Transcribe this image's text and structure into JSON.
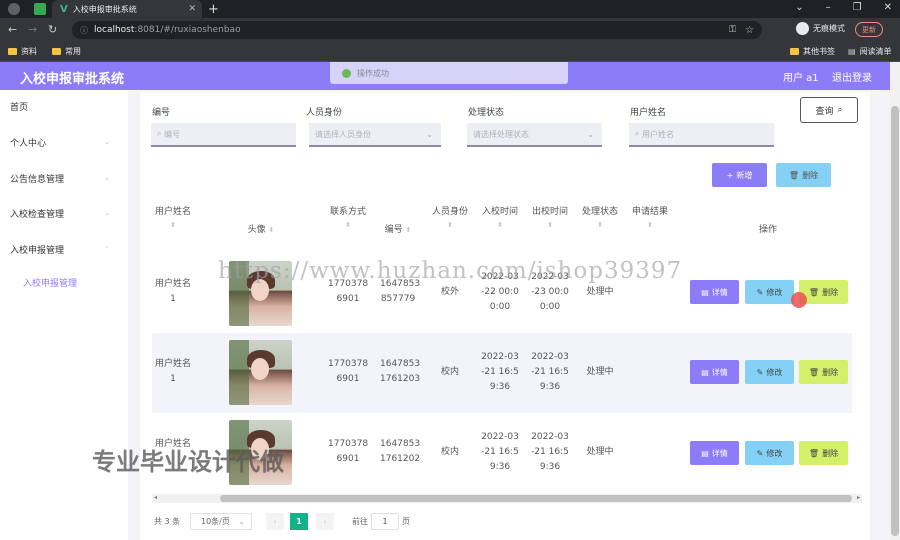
{
  "browser": {
    "tab_title": "入校申报审批系统",
    "new_tab": "+",
    "url_host": "localhost",
    "url_path": ":8081/#/ruxiaoshenbao",
    "incognito_label": "无痕模式",
    "update_label": "更新",
    "bookmarks": [
      "资料",
      "常用"
    ],
    "bookmarks_right": [
      "其他书签",
      "阅读清单"
    ]
  },
  "header": {
    "title": "入校申报审批系统",
    "toast": "操作成功",
    "user_label": "用户 a1",
    "logout_label": "退出登录"
  },
  "sidebar": {
    "items": [
      {
        "label": "首页"
      },
      {
        "label": "个人中心"
      },
      {
        "label": "公告信息管理"
      },
      {
        "label": "入校检查管理"
      },
      {
        "label": "入校申报管理"
      }
    ],
    "sub_item": "入校申报管理"
  },
  "filters": {
    "fields": [
      {
        "label": "编号",
        "placeholder": "编号"
      },
      {
        "label": "人员身份",
        "placeholder": "请选择人员身份"
      },
      {
        "label": "处理状态",
        "placeholder": "请选择处理状态"
      },
      {
        "label": "用户姓名",
        "placeholder": "用户姓名"
      }
    ],
    "query_label": "查询",
    "add_label": "新增",
    "delete_label": "删除"
  },
  "table": {
    "columns": [
      "用户姓名",
      "头像",
      "联系方式",
      "编号",
      "人员身份",
      "入校时间",
      "出校时间",
      "处理状态",
      "申请结果",
      "操作"
    ],
    "rows": [
      {
        "name": "用户姓名\n1",
        "phone": "1770378\n6901",
        "code": "1647853\n857779",
        "identity": "校外",
        "in_time": "2022-03\n-22 00:0\n0:00",
        "out_time": "2022-03\n-23 00:0\n0:00",
        "status": "处理中",
        "result": ""
      },
      {
        "name": "用户姓名\n1",
        "phone": "1770378\n6901",
        "code": "1647853\n1761203",
        "identity": "校内",
        "in_time": "2022-03\n-21 16:5\n9:36",
        "out_time": "2022-03\n-21 16:5\n9:36",
        "status": "处理中",
        "result": ""
      },
      {
        "name": "用户姓名",
        "phone": "1770378\n6901",
        "code": "1647853\n1761202",
        "identity": "校内",
        "in_time": "2022-03\n-21 16:5\n9:36",
        "out_time": "2022-03\n-21 16:5\n9:36",
        "status": "处理中",
        "result": ""
      }
    ],
    "row_actions": {
      "detail": "详情",
      "edit": "修改",
      "delete": "删除"
    }
  },
  "pagination": {
    "total": "共 3 条",
    "page_size": "10条/页",
    "current_page": "1",
    "goto_prefix": "前往",
    "goto_value": "1",
    "goto_suffix": "页"
  },
  "watermark": {
    "url": "https://www.huzhan.com/ishop39397",
    "caption": "专业毕业设计代做"
  },
  "colors": {
    "accent": "#8c7cf7",
    "edit": "#85d0f5",
    "delete": "#d2f06a"
  }
}
